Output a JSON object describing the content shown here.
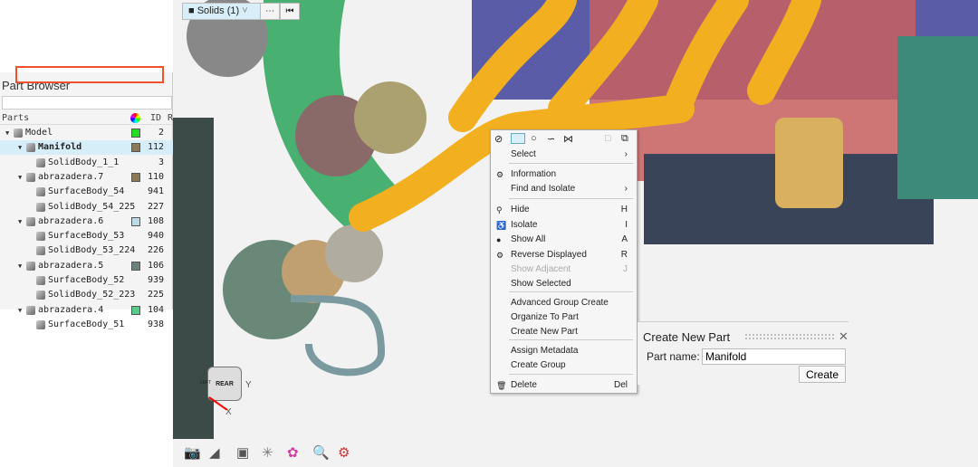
{
  "part_browser": {
    "title": "Part Browser",
    "search_placeholder": "",
    "columns": {
      "parts": "Parts",
      "id": "ID",
      "extra": "R"
    },
    "rows": [
      {
        "label": "Model",
        "id": "2",
        "color": "#22dd22",
        "level": 0,
        "kind": "model"
      },
      {
        "label": "Manifold",
        "id": "112",
        "color": "#8b7a55",
        "level": 1,
        "kind": "part",
        "selected": true
      },
      {
        "label": "SolidBody_1_1",
        "id": "3",
        "level": 2,
        "kind": "solid"
      },
      {
        "label": "abrazadera.7",
        "id": "110",
        "color": "#8b7a55",
        "level": 1,
        "kind": "part"
      },
      {
        "label": "SurfaceBody_54",
        "id": "941",
        "level": 2,
        "kind": "surface"
      },
      {
        "label": "SolidBody_54_225",
        "id": "227",
        "level": 2,
        "kind": "solid"
      },
      {
        "label": "abrazadera.6",
        "id": "108",
        "color": "#b8dbe6",
        "level": 1,
        "kind": "part"
      },
      {
        "label": "SurfaceBody_53",
        "id": "940",
        "level": 2,
        "kind": "surface"
      },
      {
        "label": "SolidBody_53_224",
        "id": "226",
        "level": 2,
        "kind": "solid"
      },
      {
        "label": "abrazadera.5",
        "id": "106",
        "color": "#6d8080",
        "level": 1,
        "kind": "part"
      },
      {
        "label": "SurfaceBody_52",
        "id": "939",
        "level": 2,
        "kind": "surface"
      },
      {
        "label": "SolidBody_52_223",
        "id": "225",
        "level": 2,
        "kind": "solid"
      },
      {
        "label": "abrazadera.4",
        "id": "104",
        "color": "#55cc88",
        "level": 1,
        "kind": "part"
      },
      {
        "label": "SurfaceBody_51",
        "id": "938",
        "level": 2,
        "kind": "surface"
      }
    ]
  },
  "toolbar": {
    "selector": "Solids (1)",
    "more": "⋯",
    "end": "⏮"
  },
  "menu": {
    "items": [
      {
        "label": "Select",
        "key": "›"
      },
      {
        "label": "Information",
        "key": "",
        "icon": "information-icon"
      },
      {
        "label": "Find and Isolate",
        "key": "›"
      },
      {
        "label": "Hide",
        "key": "H",
        "icon": "hide-icon"
      },
      {
        "label": "Isolate",
        "key": "I",
        "icon": "isolate-icon"
      },
      {
        "label": "Show All",
        "key": "A",
        "icon": "show-all-icon"
      },
      {
        "label": "Reverse Displayed",
        "key": "R",
        "icon": "reverse-icon"
      },
      {
        "label": "Show Adjacent",
        "key": "J",
        "disabled": true
      },
      {
        "label": "Show Selected",
        "key": ""
      },
      {
        "label": "Advanced Group Create",
        "key": ""
      },
      {
        "label": "Organize To Part",
        "key": ""
      },
      {
        "label": "Create New Part",
        "key": "",
        "highlighted": true
      },
      {
        "label": "Assign Metadata",
        "key": ""
      },
      {
        "label": "Create Group",
        "key": ""
      },
      {
        "label": "Delete",
        "key": "Del",
        "icon": "trash-icon"
      }
    ]
  },
  "create_part": {
    "title": "Create New Part",
    "label": "Part name:",
    "value": "Manifold",
    "button": "Create",
    "close": "✕"
  },
  "viewcube": {
    "face": "REAR",
    "side": "LEFT",
    "x": "X",
    "y": "Y"
  },
  "colors": {
    "highlight": "#f0502a",
    "selection": "#d6eef8",
    "manifold": "#f2b020"
  }
}
